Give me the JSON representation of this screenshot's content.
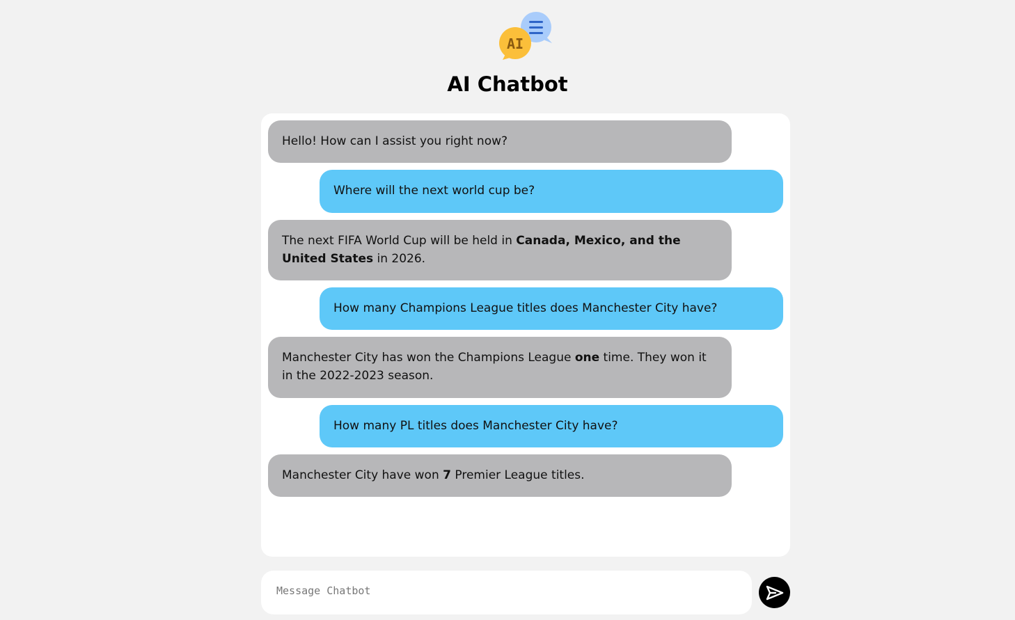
{
  "header": {
    "logo_text": "AI",
    "title": "AI Chatbot"
  },
  "messages": [
    {
      "role": "bot",
      "parts": [
        {
          "text": "Hello! How can I assist you right now?"
        }
      ]
    },
    {
      "role": "user",
      "parts": [
        {
          "text": "Where will the next world cup be?"
        }
      ]
    },
    {
      "role": "bot",
      "parts": [
        {
          "text": "The next FIFA World Cup will be held in "
        },
        {
          "text": "Canada, Mexico, and the United States",
          "bold": true
        },
        {
          "text": " in 2026."
        }
      ]
    },
    {
      "role": "user",
      "parts": [
        {
          "text": "How many Champions League titles does Manchester City have?"
        }
      ]
    },
    {
      "role": "bot",
      "parts": [
        {
          "text": "Manchester City has won the Champions League "
        },
        {
          "text": "one",
          "bold": true
        },
        {
          "text": " time. They won it in the 2022-2023 season."
        }
      ]
    },
    {
      "role": "user",
      "parts": [
        {
          "text": "How many PL titles does Manchester City have?"
        }
      ]
    },
    {
      "role": "bot",
      "parts": [
        {
          "text": "Manchester City have won "
        },
        {
          "text": "7",
          "bold": true
        },
        {
          "text": " Premier League titles."
        }
      ]
    }
  ],
  "composer": {
    "placeholder": "Message Chatbot",
    "value": ""
  },
  "icons": {
    "logo": "chat-bubbles-ai-icon",
    "send": "send-arrow-icon"
  },
  "colors": {
    "bot_bubble": "#b7b7b9",
    "user_bubble": "#5ec8f8",
    "logo_front": "#fbbf3a",
    "logo_back": "#a9ccfb",
    "send_button": "#000000"
  }
}
